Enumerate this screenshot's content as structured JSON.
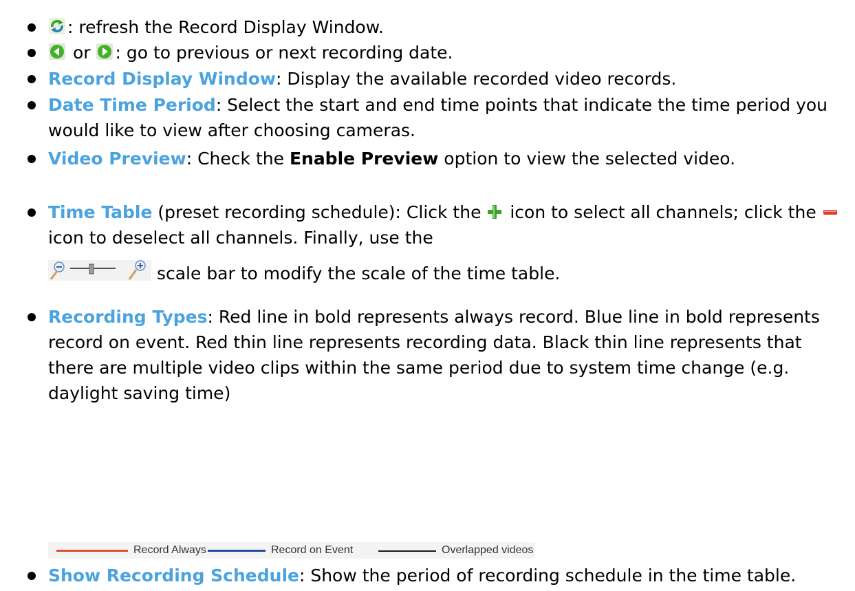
{
  "items": [
    {
      "icon": "refresh-icon",
      "text": ": refresh the Record Display Window."
    },
    {
      "icon_prev": "previous-date-icon",
      "or_text": " or ",
      "icon_next": "next-date-icon",
      "text": ": go to previous or next recording date."
    },
    {
      "term": "Record Display Window",
      "text": ": Display the available recorded video records."
    },
    {
      "term": "Date Time Period",
      "text": ": Select the start and end time points that indicate the time period you would like to view after choosing cameras."
    },
    {
      "term": "Video Preview",
      "text_before": ": Check the ",
      "strong": "Enable Preview",
      "text_after": " option to view the selected video."
    },
    {
      "term": "Time Table",
      "text_1": " (preset recording schedule): Click the ",
      "icon_add": "plus-icon",
      "text_2": " icon to select all channels; click the ",
      "icon_remove": "minus-icon",
      "text_3": " icon to deselect all channels. Finally, use the",
      "scale_icon": "zoom-scale-bar",
      "text_4": " scale bar to modify the scale of the time table."
    },
    {
      "term": "Recording Types",
      "text": ": Red line in bold represents always record. Blue line in bold represents record on event. Red thin line represents recording data. Black thin line represents that there are multiple video clips within the same period due to system time change (e.g. daylight saving time)"
    },
    {
      "term": "Show Recording Schedule",
      "text": ": Show the period of recording schedule in the time table."
    }
  ],
  "legend": {
    "always": {
      "label": "Record Always",
      "color": "#d9532b"
    },
    "event": {
      "label": "Record on Event",
      "color": "#1f4e9c"
    },
    "overlap": {
      "label": "Overlapped videos",
      "color": "#1a1a1a"
    }
  },
  "colors": {
    "term": "#4aa3df",
    "text": "#000000"
  }
}
